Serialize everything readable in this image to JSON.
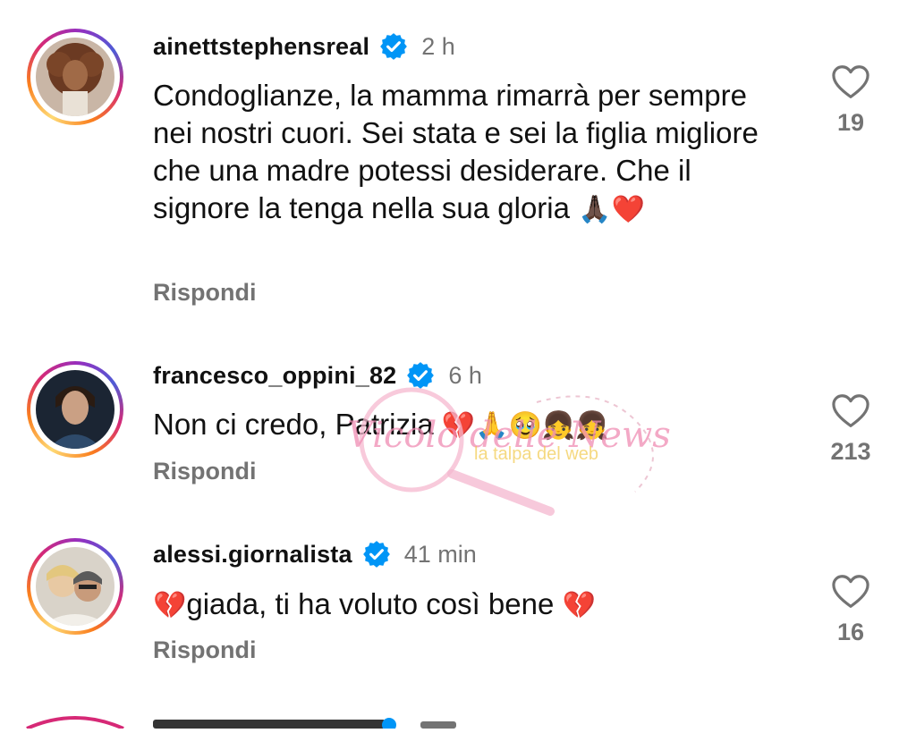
{
  "comments": [
    {
      "username": "ainettstephensreal",
      "time": "2 h",
      "text": "Condoglianze, la mamma rimarrà per sempre nei nostri cuori. Sei stata e sei la figlia migliore che una madre potessi desiderare. Che il signore la tenga nella sua gloria",
      "emojis": "🙏🏿❤️",
      "reply_label": "Rispondi",
      "likes": "19"
    },
    {
      "username": "francesco_oppini_82",
      "time": "6 h",
      "text": "Non ci credo, Patrizia",
      "emojis": "💔🙏🥹👧👧",
      "reply_label": "Rispondi",
      "likes": "213"
    },
    {
      "username": "alessi.giornalista",
      "time": "41 min",
      "text_prefix_emoji": "💔",
      "text": "giada, ti ha voluto così bene",
      "emojis": "💔",
      "reply_label": "Rispondi",
      "likes": "16"
    }
  ],
  "watermark": {
    "brand": "Vicolo delle News",
    "subtitle": "la talpa del web"
  },
  "colors": {
    "verified": "#0095f6",
    "secondary_text": "#737373",
    "ring_start": "#feda75",
    "ring_end": "#962fbf"
  },
  "icons": [
    "heart-outline-icon",
    "verified-badge-icon"
  ]
}
